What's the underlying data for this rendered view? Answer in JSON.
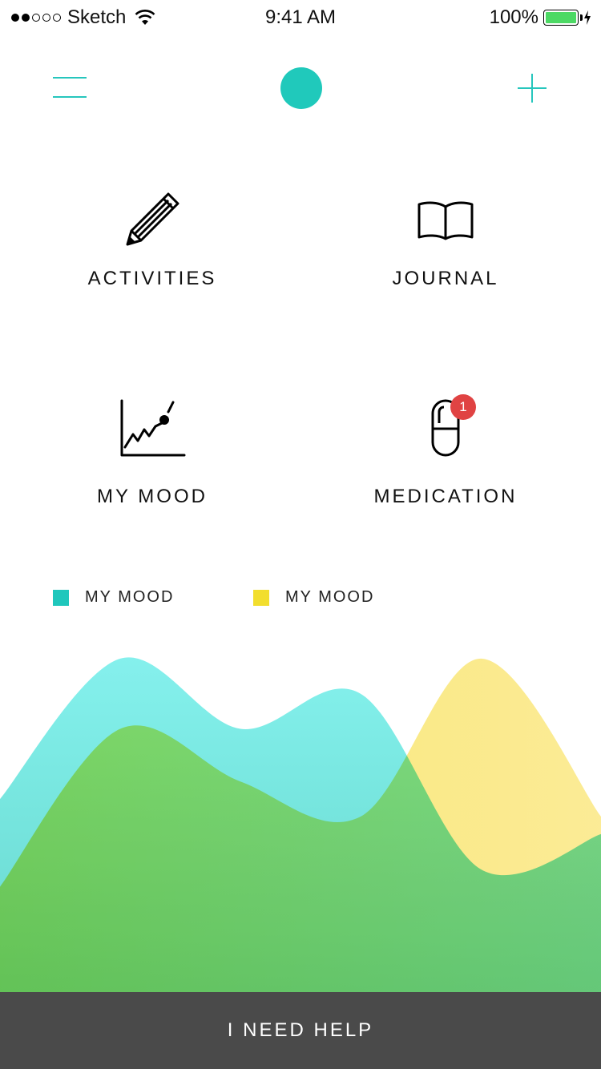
{
  "status_bar": {
    "carrier": "Sketch",
    "time": "9:41 AM",
    "battery": "100%",
    "signal_bars": 2,
    "signal_total": 5
  },
  "nav": {
    "menu_icon": "hamburger-icon",
    "avatar_color": "#20c9bb",
    "add_icon": "plus-icon",
    "accent": "#26c6bd"
  },
  "tiles": [
    {
      "label": "ACTIVITIES",
      "icon": "pencil-icon"
    },
    {
      "label": "JOURNAL",
      "icon": "book-icon"
    },
    {
      "label": "MY MOOD",
      "icon": "mood-chart-icon"
    },
    {
      "label": "MEDICATION",
      "icon": "pill-icon",
      "badge": "1"
    }
  ],
  "chart_data": {
    "type": "area",
    "legend_position": "top-left",
    "series": [
      {
        "name": "MY MOOD",
        "color": "#1fc7bc",
        "values": [
          55,
          95,
          75,
          85,
          35,
          45
        ]
      },
      {
        "name": "MY MOOD",
        "color": "#f2de2e",
        "values": [
          30,
          75,
          60,
          50,
          95,
          50
        ]
      }
    ],
    "ylim": [
      0,
      100
    ]
  },
  "help_label": "I NEED HELP"
}
